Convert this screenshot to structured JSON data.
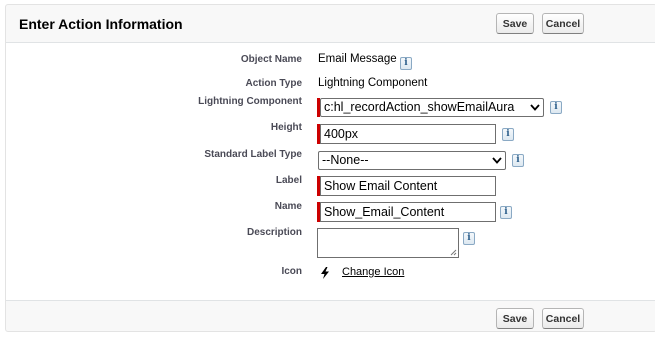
{
  "header": {
    "title": "Enter Action Information",
    "save_label": "Save",
    "cancel_label": "Cancel"
  },
  "fields": {
    "object_name": {
      "label": "Object Name",
      "value": "Email Message"
    },
    "action_type": {
      "label": "Action Type",
      "value": "Lightning Component"
    },
    "lightning_component": {
      "label": "Lightning Component",
      "value": "c:hl_recordAction_showEmailAura"
    },
    "height": {
      "label": "Height",
      "value": "400px"
    },
    "standard_label_type": {
      "label": "Standard Label Type",
      "value": "--None--"
    },
    "label": {
      "label": "Label",
      "value": "Show Email Content"
    },
    "name": {
      "label": "Name",
      "value": "Show_Email_Content"
    },
    "description": {
      "label": "Description",
      "value": ""
    },
    "icon": {
      "label": "Icon",
      "link_text": "Change Icon",
      "icon_name": "lightning-bolt-icon"
    }
  },
  "info_glyph": "i",
  "footer": {
    "save_label": "Save",
    "cancel_label": "Cancel"
  },
  "colors": {
    "required_bar": "#cc0000",
    "panel_background": "#f8f8f8"
  }
}
